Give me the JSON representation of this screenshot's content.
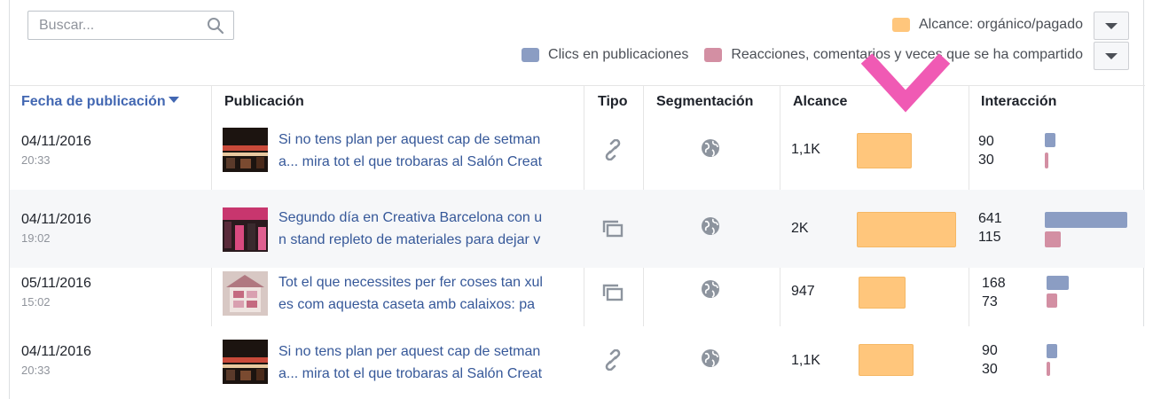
{
  "search": {
    "placeholder": "Buscar..."
  },
  "legend": {
    "reach": "Alcance: orgánico/pagado",
    "clicks": "Clics en publicaciones",
    "reactions": "Reacciones, comentarios y veces que se ha compartido"
  },
  "colors": {
    "reach": "#ffc67c",
    "clicks": "#8b9dc3",
    "reactions": "#d38fa3",
    "link": "#365899",
    "accent_arrow": "#f05ab4"
  },
  "table": {
    "headers": {
      "date": "Fecha de publicación",
      "post": "Publicación",
      "type": "Tipo",
      "targeting": "Segmentación",
      "reach": "Alcance",
      "engagement": "Interacción"
    },
    "rows": [
      {
        "date": "04/11/2016",
        "time": "20:33",
        "text1": "Si no tens plan per aquest cap de setman",
        "text2": "a... mira tot el que trobaras al Salón Creat",
        "type_icon": "link-icon",
        "targeting_icon": "globe-icon",
        "reach": "1,1K",
        "clicks": "90",
        "reactions": "30"
      },
      {
        "date": "04/11/2016",
        "time": "19:02",
        "text1": "Segundo día en Creativa Barcelona con u",
        "text2": "n stand repleto de materiales para dejar v",
        "type_icon": "album-icon",
        "targeting_icon": "globe-icon",
        "reach": "2K",
        "clicks": "641",
        "reactions": "115"
      },
      {
        "date": "05/11/2016",
        "time": "15:02",
        "text1": "Tot el que necessites per fer coses tan xul",
        "text2": "es com aquesta caseta amb calaixos: pa",
        "type_icon": "album-icon",
        "targeting_icon": "globe-icon",
        "reach": "947",
        "clicks": "168",
        "reactions": "73"
      },
      {
        "date": "04/11/2016",
        "time": "20:33",
        "text1": "Si no tens plan per aquest cap de setman",
        "text2": "a... mira tot el que trobaras al Salón Creat",
        "type_icon": "link-icon",
        "targeting_icon": "globe-icon",
        "reach": "1,1K",
        "clicks": "90",
        "reactions": "30"
      }
    ]
  }
}
